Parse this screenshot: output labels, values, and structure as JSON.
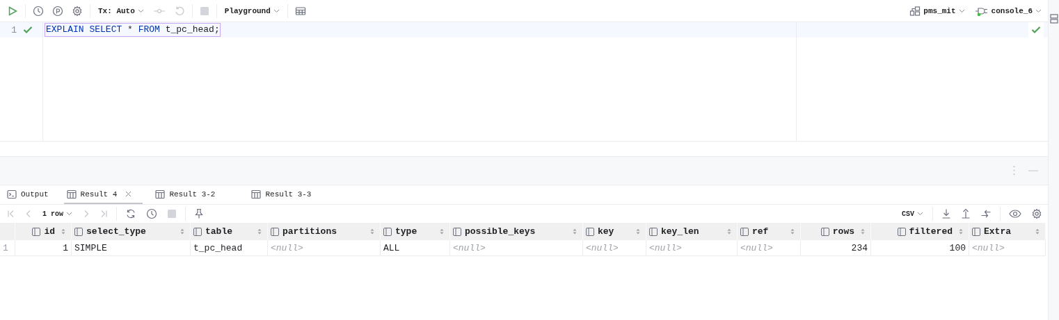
{
  "toolbar": {
    "tx_mode": "Tx: Auto",
    "playground": "Playground",
    "datasource": "pms_mit",
    "console": "console_6",
    "console_connected": true
  },
  "editor": {
    "lines": [
      {
        "number": "1",
        "executed": true,
        "tokens": [
          {
            "kind": "keyword",
            "text": "EXPLAIN"
          },
          {
            "kind": "keyword",
            "text": "SELECT"
          },
          {
            "kind": "plain",
            "text": "*"
          },
          {
            "kind": "keyword",
            "text": "FROM"
          },
          {
            "kind": "ident",
            "text": "t_pc_head;"
          }
        ]
      }
    ],
    "checked": true
  },
  "result_tabs": [
    {
      "label": "Output",
      "kind": "console",
      "selected": false,
      "closable": false
    },
    {
      "label": "Result 4",
      "kind": "result",
      "selected": true,
      "closable": true
    },
    {
      "label": "Result 3-2",
      "kind": "result",
      "selected": false,
      "closable": false
    },
    {
      "label": "Result 3-3",
      "kind": "result",
      "selected": false,
      "closable": false
    }
  ],
  "result_toolbar": {
    "row_count": "1 row",
    "export_format": "CSV"
  },
  "table": {
    "columns": [
      {
        "name": "id",
        "kind": "number"
      },
      {
        "name": "select_type",
        "kind": "text"
      },
      {
        "name": "table",
        "kind": "text"
      },
      {
        "name": "partitions",
        "kind": "text"
      },
      {
        "name": "type",
        "kind": "text"
      },
      {
        "name": "possible_keys",
        "kind": "text"
      },
      {
        "name": "key",
        "kind": "text"
      },
      {
        "name": "key_len",
        "kind": "text"
      },
      {
        "name": "ref",
        "kind": "text"
      },
      {
        "name": "rows",
        "kind": "number"
      },
      {
        "name": "filtered",
        "kind": "number"
      },
      {
        "name": "Extra",
        "kind": "text"
      }
    ],
    "rows": [
      {
        "number": "1",
        "cells": [
          {
            "text": "1",
            "null": false
          },
          {
            "text": "SIMPLE",
            "null": false
          },
          {
            "text": "t_pc_head",
            "null": false
          },
          {
            "text": "<null>",
            "null": true
          },
          {
            "text": "ALL",
            "null": false
          },
          {
            "text": "<null>",
            "null": true
          },
          {
            "text": "<null>",
            "null": true
          },
          {
            "text": "<null>",
            "null": true
          },
          {
            "text": "<null>",
            "null": true
          },
          {
            "text": "234",
            "null": false
          },
          {
            "text": "100",
            "null": false
          },
          {
            "text": "<null>",
            "null": true
          }
        ]
      }
    ]
  }
}
